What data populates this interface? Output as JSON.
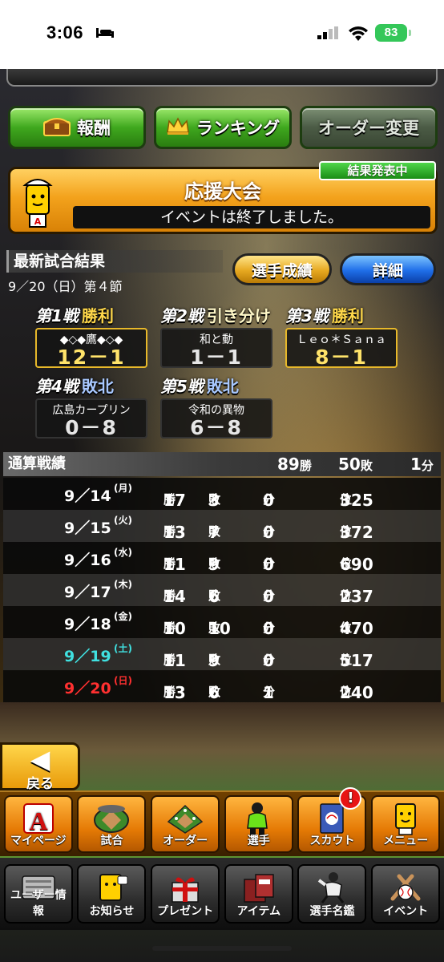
{
  "status_bar": {
    "time": "3:06",
    "battery": "83"
  },
  "top_buttons": {
    "reward": "報酬",
    "ranking": "ランキング",
    "order_change": "オーダー変更"
  },
  "event": {
    "title": "応援大会",
    "message": "イベントは終了しました。",
    "badge": "結果発表中"
  },
  "latest": {
    "header": "最新試合結果",
    "date": "9／20（日）第４節",
    "player_stats_button": "選手成績",
    "detail_button": "詳細",
    "matches": [
      {
        "label": "第1戦",
        "result": "勝利",
        "opponent": "◆◇◆鷹◆◇◆",
        "score": "12－1"
      },
      {
        "label": "第2戦",
        "result": "引き分け",
        "opponent": "和と動",
        "score": "1－1"
      },
      {
        "label": "第3戦",
        "result": "勝利",
        "opponent": "Ｌｅｏ＊Ｓａｎａ",
        "score": "8－1"
      },
      {
        "label": "第4戦",
        "result": "敗北",
        "opponent": "広島カープリン",
        "score": "0－8"
      },
      {
        "label": "第5戦",
        "result": "敗北",
        "opponent": "令和の異物",
        "score": "6－8"
      }
    ]
  },
  "total": {
    "header": "通算戦績",
    "wins": "89",
    "wins_unit": "勝",
    "losses": "50",
    "losses_unit": "敗",
    "draws": "1",
    "draws_unit": "分",
    "rows": [
      {
        "date": "9／14",
        "dow": "(月)",
        "wins": "17",
        "losses": "3",
        "draws": "0",
        "rank": "325"
      },
      {
        "date": "9／15",
        "dow": "(火)",
        "wins": "13",
        "losses": "7",
        "draws": "0",
        "rank": "372"
      },
      {
        "date": "9／16",
        "dow": "(水)",
        "wins": "11",
        "losses": "9",
        "draws": "0",
        "rank": "690"
      },
      {
        "date": "9／17",
        "dow": "(木)",
        "wins": "14",
        "losses": "6",
        "draws": "0",
        "rank": "237"
      },
      {
        "date": "9／18",
        "dow": "(金)",
        "wins": "10",
        "losses": "10",
        "draws": "0",
        "rank": "470"
      },
      {
        "date": "9／19",
        "dow": "(土)",
        "wins": "11",
        "losses": "9",
        "draws": "0",
        "rank": "517"
      },
      {
        "date": "9／20",
        "dow": "(日)",
        "wins": "13",
        "losses": "6",
        "draws": "1",
        "rank": "240"
      }
    ],
    "units": {
      "win": "勝",
      "loss": "敗",
      "draw": "分",
      "rank": "位"
    }
  },
  "back_button": "戻る",
  "nav_main": [
    "マイページ",
    "試合",
    "オーダー",
    "選手",
    "スカウト",
    "メニュー"
  ],
  "nav_sub": [
    "ユーザー情報",
    "お知らせ",
    "プレゼント",
    "アイテム",
    "選手名鑑",
    "イベント"
  ],
  "notification_mark": "!",
  "colors": {
    "green": "#3fa81e",
    "gold": "#e6a820",
    "blue": "#1f6ee8",
    "saturday": "#40e0e0",
    "sunday": "#ff3030"
  }
}
